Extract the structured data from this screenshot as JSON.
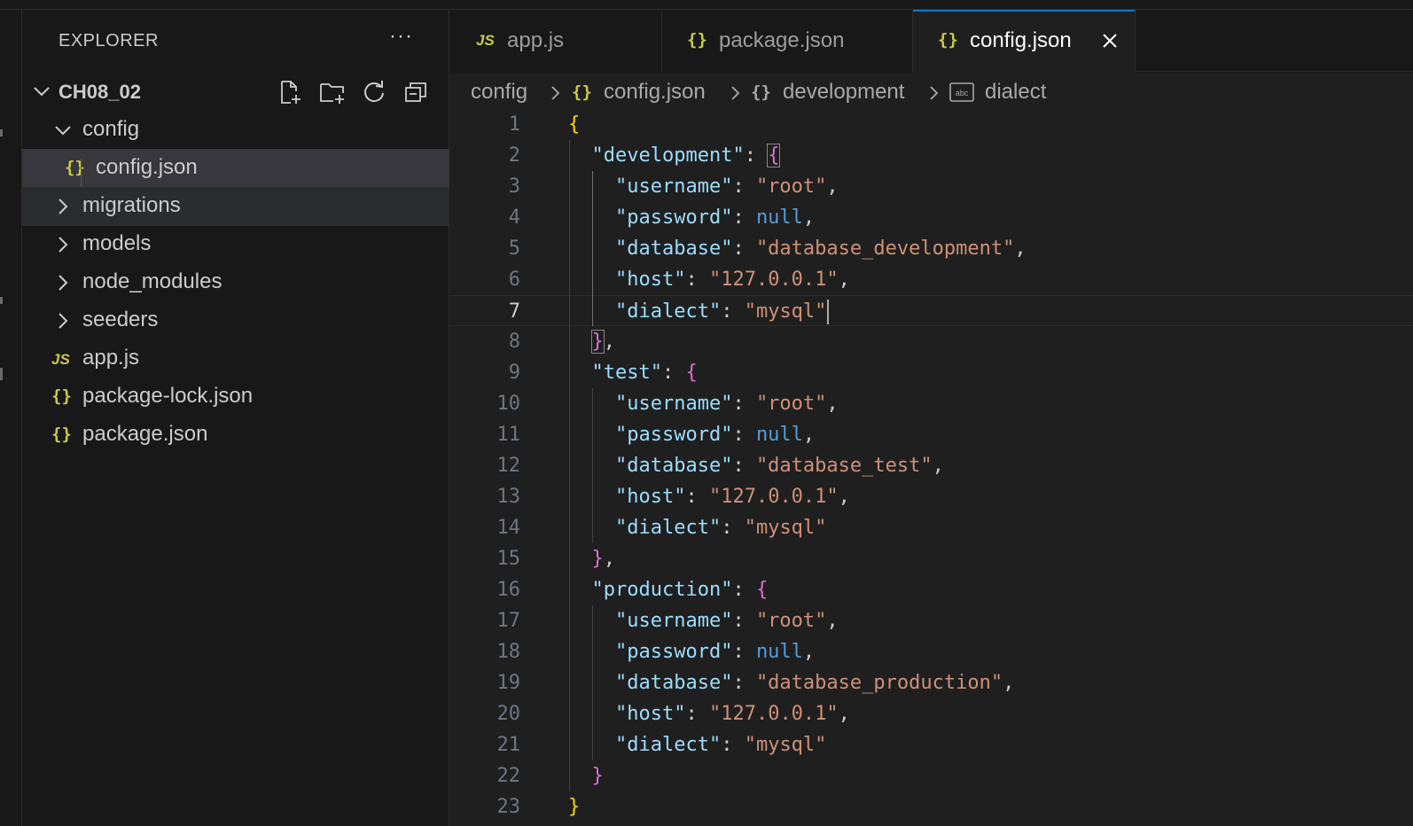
{
  "colors": {
    "accent": "#0078d4",
    "json_icon": "#cbcb41",
    "js_icon": "#cbcb41",
    "key": "#9cdcfe",
    "string": "#ce9178",
    "literal": "#569cd6",
    "bracket_level1": "#ffd700",
    "bracket_level2": "#da70d6"
  },
  "sidebar": {
    "title": "EXPLORER",
    "more_label": "···",
    "project": {
      "name": "CH08_02",
      "actions": [
        "new-file-icon",
        "new-folder-icon",
        "refresh-icon",
        "collapse-all-icon"
      ]
    },
    "tree": [
      {
        "label": "config",
        "type": "folder",
        "expanded": true
      },
      {
        "label": "config.json",
        "type": "json",
        "icon": "{}",
        "selected": true
      },
      {
        "label": "migrations",
        "type": "folder",
        "expanded": false
      },
      {
        "label": "models",
        "type": "folder",
        "expanded": false
      },
      {
        "label": "node_modules",
        "type": "folder",
        "expanded": false
      },
      {
        "label": "seeders",
        "type": "folder",
        "expanded": false
      },
      {
        "label": "app.js",
        "type": "js",
        "icon": "JS"
      },
      {
        "label": "package-lock.json",
        "type": "json",
        "icon": "{}"
      },
      {
        "label": "package.json",
        "type": "json",
        "icon": "{}"
      }
    ]
  },
  "tabs": [
    {
      "label": "app.js",
      "icon": "JS",
      "active": false
    },
    {
      "label": "package.json",
      "icon": "{}",
      "active": false
    },
    {
      "label": "config.json",
      "icon": "{}",
      "active": true
    }
  ],
  "breadcrumb": [
    {
      "label": "config"
    },
    {
      "label": "config.json",
      "icon": "{}"
    },
    {
      "label": "development",
      "icon": "{}"
    },
    {
      "label": "dialect",
      "icon": "abc"
    }
  ],
  "editor": {
    "current_line": 7,
    "lines": [
      {
        "n": "1",
        "text": "{"
      },
      {
        "n": "2",
        "text": "  \"development\": {"
      },
      {
        "n": "3",
        "text": "    \"username\": \"root\","
      },
      {
        "n": "4",
        "text": "    \"password\": null,"
      },
      {
        "n": "5",
        "text": "    \"database\": \"database_development\","
      },
      {
        "n": "6",
        "text": "    \"host\": \"127.0.0.1\","
      },
      {
        "n": "7",
        "text": "    \"dialect\": \"mysql\""
      },
      {
        "n": "8",
        "text": "  },"
      },
      {
        "n": "9",
        "text": "  \"test\": {"
      },
      {
        "n": "10",
        "text": "    \"username\": \"root\","
      },
      {
        "n": "11",
        "text": "    \"password\": null,"
      },
      {
        "n": "12",
        "text": "    \"database\": \"database_test\","
      },
      {
        "n": "13",
        "text": "    \"host\": \"127.0.0.1\","
      },
      {
        "n": "14",
        "text": "    \"dialect\": \"mysql\""
      },
      {
        "n": "15",
        "text": "  },"
      },
      {
        "n": "16",
        "text": "  \"production\": {"
      },
      {
        "n": "17",
        "text": "    \"username\": \"root\","
      },
      {
        "n": "18",
        "text": "    \"password\": null,"
      },
      {
        "n": "19",
        "text": "    \"database\": \"database_production\","
      },
      {
        "n": "20",
        "text": "    \"host\": \"127.0.0.1\","
      },
      {
        "n": "21",
        "text": "    \"dialect\": \"mysql\""
      },
      {
        "n": "22",
        "text": "  }"
      },
      {
        "n": "23",
        "text": "}"
      }
    ]
  }
}
